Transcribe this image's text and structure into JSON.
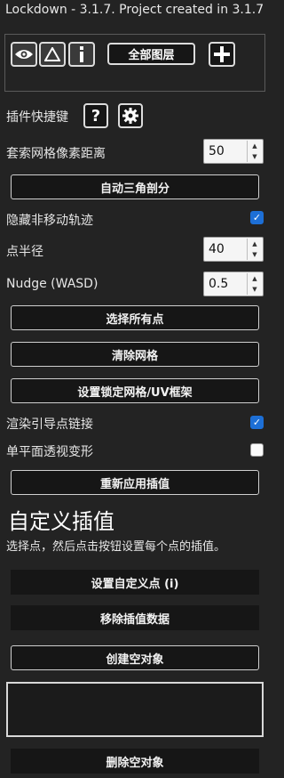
{
  "window": {
    "title": "Lockdown - 3.1.7. Project created in 3.1.7"
  },
  "toolbar": {
    "eye_icon": "eye-icon",
    "warning_icon": "triangle-warning-icon",
    "info_icon": "info-icon",
    "all_layers_label": "全部图层",
    "add_icon": "plus-icon"
  },
  "plugin_shortcuts": {
    "label": "插件快捷键",
    "help_icon": "question-icon",
    "settings_icon": "gear-icon"
  },
  "mesh_pixel_distance": {
    "label": "套索网格像素距离",
    "value": "50"
  },
  "auto_triangulate_label": "自动三角剖分",
  "hide_non_moving": {
    "label": "隐藏非移动轨迹",
    "checked": true
  },
  "point_radius": {
    "label": "点半径",
    "value": "40"
  },
  "nudge": {
    "label": "Nudge (WASD)",
    "value": "0.5"
  },
  "buttons": {
    "select_all": "选择所有点",
    "clear_mesh": "清除网格",
    "set_lock_mesh": "设置锁定网格/UV框架",
    "reapply": "重新应用插值",
    "set_custom_point": "设置自定义点 (i)",
    "remove_interp": "移除插值数据",
    "create_null": "创建空对象",
    "delete_null": "删除空对象"
  },
  "render_guides": {
    "label": "渲染引导点链接",
    "checked": true
  },
  "single_plane": {
    "label": "单平面透视变形",
    "checked": false
  },
  "custom_interp": {
    "heading": "自定义插值",
    "description": "选择点，然后点击按钮设置每个点的插值。"
  },
  "colors": {
    "background": "#232323",
    "checkbox_accent": "#1d6fd6",
    "button_bg": "#161616"
  }
}
